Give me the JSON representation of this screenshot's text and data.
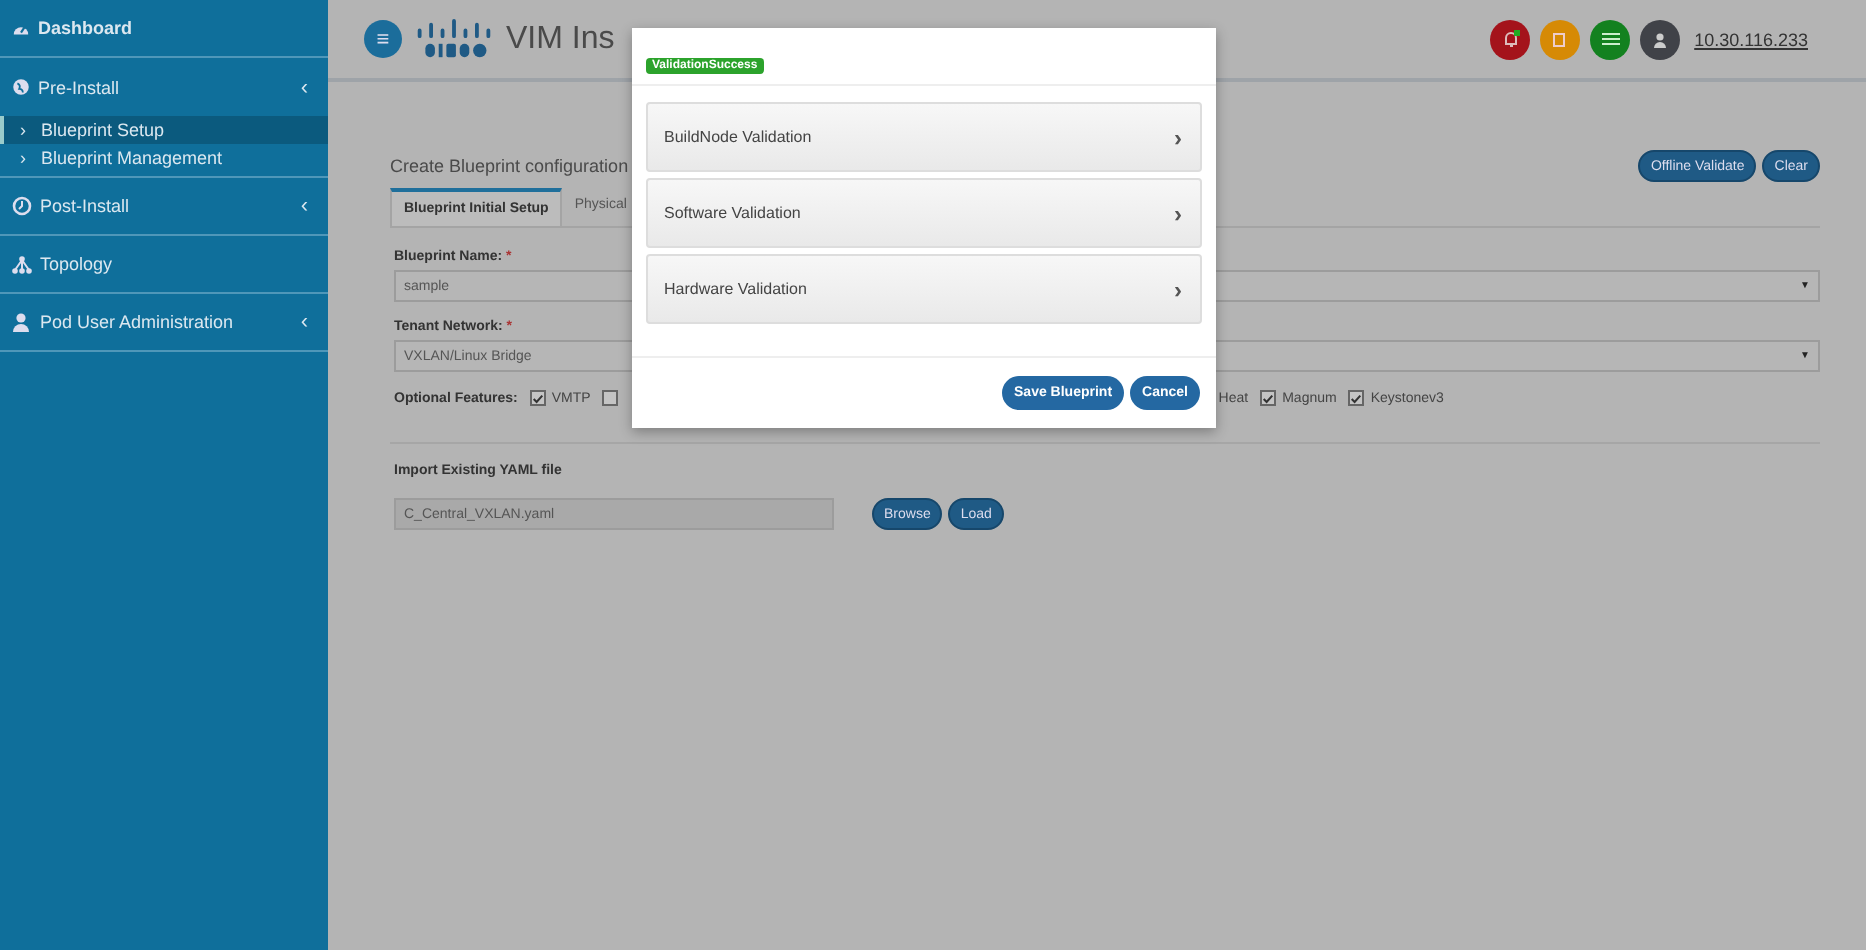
{
  "sidebar": {
    "items": [
      {
        "label": "Dashboard",
        "bold": true,
        "expanded": false
      },
      {
        "label": "Pre-Install",
        "chevron": "‹",
        "expanded": true,
        "children": [
          {
            "marker": "›",
            "label": "Blueprint Setup",
            "selected": true
          },
          {
            "marker": "›",
            "label": "Blueprint Management",
            "selected": false
          }
        ]
      },
      {
        "label": "Post-Install",
        "chevron": "‹",
        "expanded": false
      },
      {
        "label": "Topology",
        "expanded": false
      },
      {
        "label": "Pod User Administration",
        "chevron": "‹",
        "expanded": false
      }
    ]
  },
  "header": {
    "menu_glyph": "≡",
    "title": "VIM Ins",
    "ip_link": "10.30.116.233"
  },
  "page": {
    "heading": "Create Blueprint configuration",
    "actions": [
      "Offline Validate",
      "Clear"
    ],
    "tabs": [
      {
        "label": "Blueprint Initial Setup",
        "selected": true
      },
      {
        "label": "Physical",
        "selected": false
      }
    ],
    "blueprint_name": {
      "label": "Blueprint Name:",
      "required_mark": "*",
      "value": "sample",
      "caret": "▼"
    },
    "tenant_network": {
      "label": "Tenant Network:",
      "required_mark": "*",
      "value": "VXLAN/Linux Bridge",
      "caret": "▼"
    },
    "optional_features": {
      "label": "Optional Features:",
      "options": [
        {
          "kind": "checkbox",
          "label": "VMTP",
          "checked": true
        },
        {
          "kind": "checkbox",
          "checked": false
        },
        {
          "kind": "text",
          "label": "Heat"
        },
        {
          "kind": "checkbox",
          "label": "Magnum",
          "checked": true
        },
        {
          "kind": "checkbox",
          "label": "Keystonev3",
          "checked": true
        }
      ]
    },
    "import": {
      "label": "Import Existing YAML file",
      "value": "C_Central_VXLAN.yaml",
      "buttons": [
        "Browse",
        "Load"
      ]
    }
  },
  "modal": {
    "badge": "ValidationSuccess",
    "panels": [
      {
        "label": "BuildNode Validation",
        "chevron": "›"
      },
      {
        "label": "Software Validation",
        "chevron": "›"
      },
      {
        "label": "Hardware Validation",
        "chevron": "›"
      }
    ],
    "buttons": [
      "Save Blueprint",
      "Cancel"
    ]
  }
}
